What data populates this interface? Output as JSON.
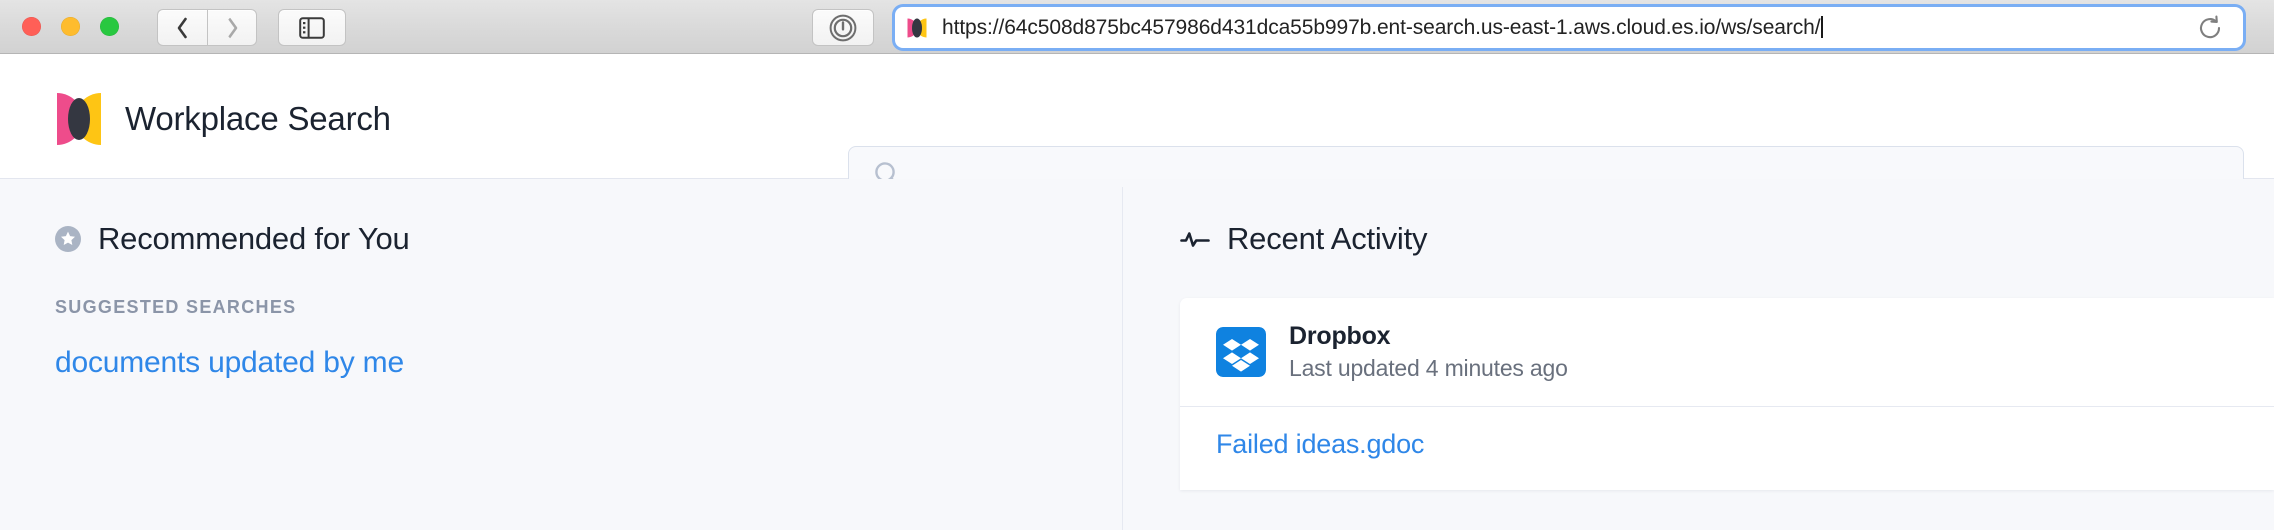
{
  "browser": {
    "traffic_lights": [
      {
        "name": "close",
        "color": "#ff5f57"
      },
      {
        "name": "minimize",
        "color": "#febc2e"
      },
      {
        "name": "zoom",
        "color": "#28c840"
      }
    ],
    "back_icon": "chevron-left-icon",
    "forward_icon": "chevron-right-icon",
    "sidebar_icon": "sidebar-toggle-icon",
    "privacy_icon": "privacy-report-icon",
    "reload_icon": "reload-icon",
    "favicon": "elastic-favicon",
    "url": "https://64c508d875bc457986d431dca55b997b.ent-search.us-east-1.aws.cloud.es.io/ws/search/"
  },
  "app": {
    "title": "Workplace Search",
    "logo": "elastic-workplace-search-logo",
    "search": {
      "value": "",
      "placeholder": "",
      "icon": "search-icon"
    }
  },
  "recommended": {
    "icon": "star-circle-icon",
    "heading": "Recommended for You",
    "suggested_label": "SUGGESTED SEARCHES",
    "suggestions": [
      "documents updated by me"
    ]
  },
  "recent_activity": {
    "icon": "pulse-icon",
    "heading": "Recent Activity",
    "items": [
      {
        "icon": "dropbox-icon",
        "icon_color": "#0f82e0",
        "name": "Dropbox",
        "subtitle": "Last updated 4 minutes ago"
      }
    ],
    "documents": [
      "Failed ideas.gdoc"
    ]
  },
  "colors": {
    "link": "#2f87e8",
    "accent_pink": "#ee4c8b",
    "accent_yellow": "#fec514",
    "text": "#1b2330",
    "muted": "#8b95a8",
    "page_bg": "#f7f8fb"
  }
}
